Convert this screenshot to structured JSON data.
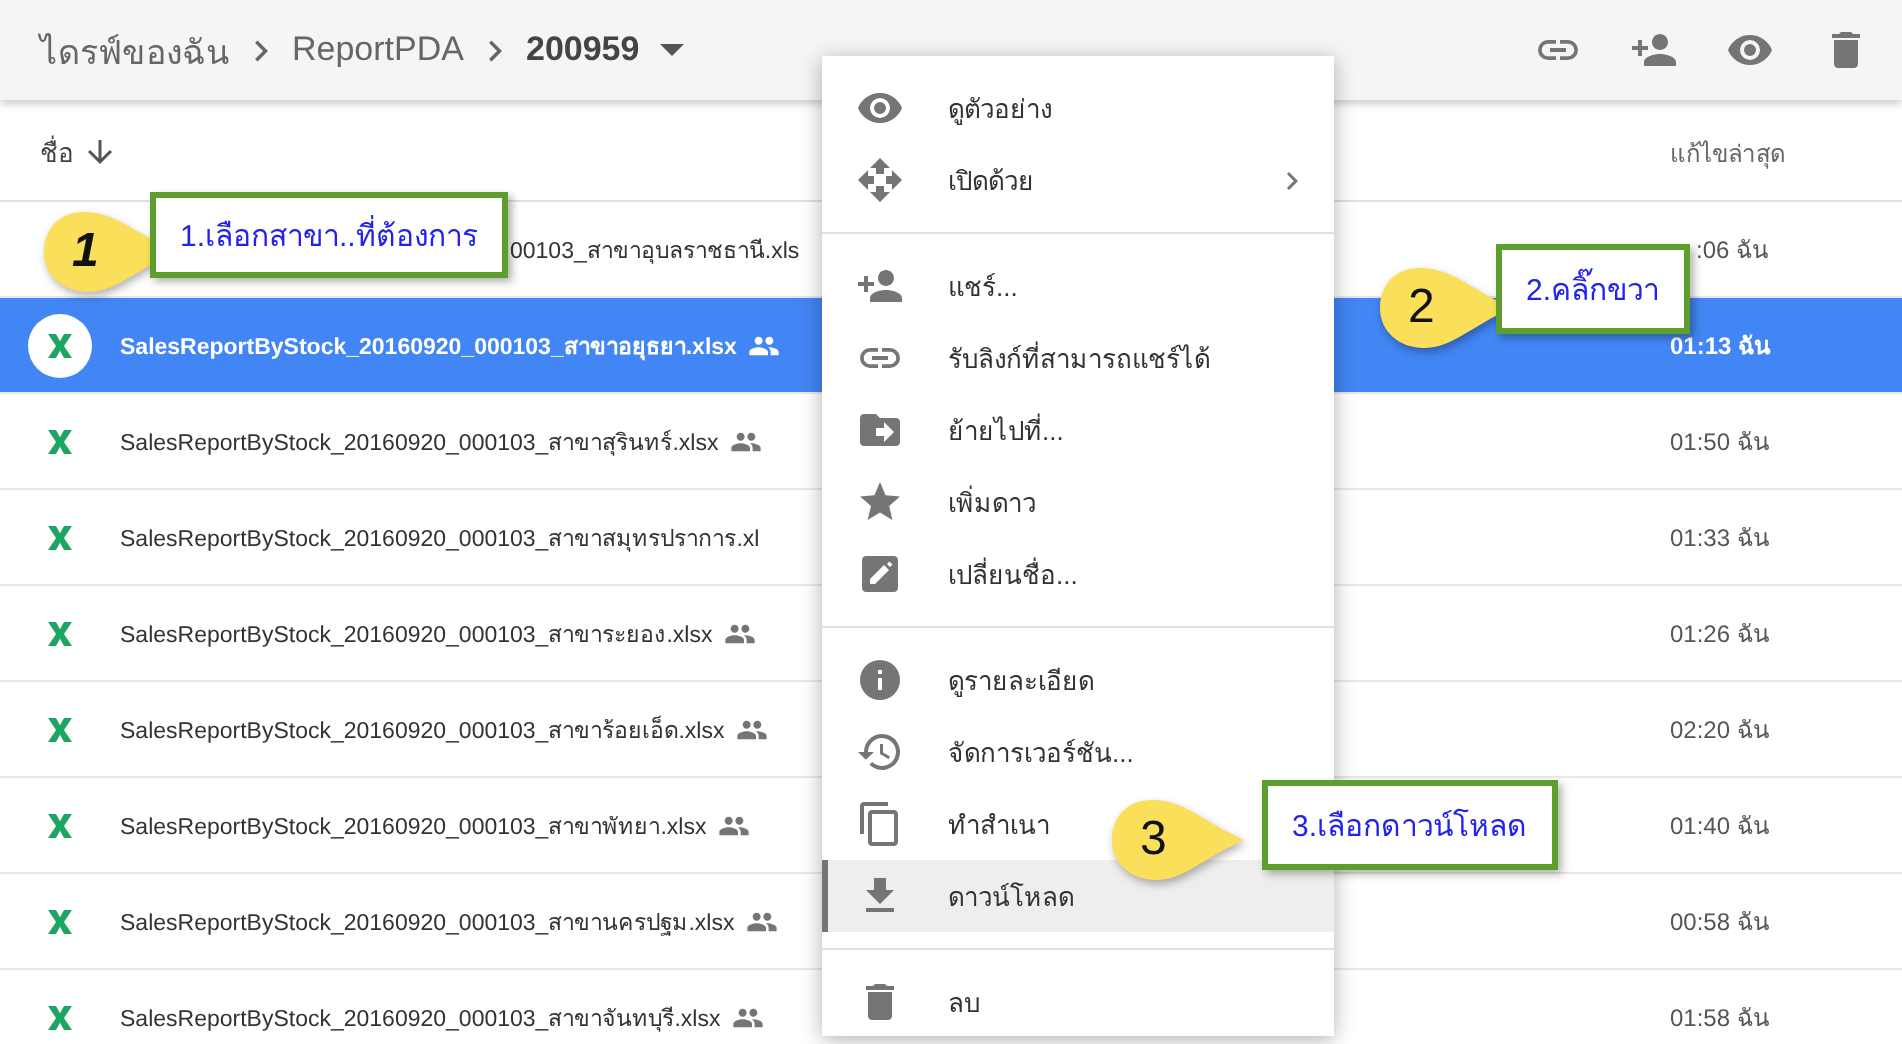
{
  "breadcrumb": [
    {
      "label": "ไดรฟ์ของฉัน",
      "current": false
    },
    {
      "label": "ReportPDA",
      "current": false
    },
    {
      "label": "200959",
      "current": true
    }
  ],
  "columns": {
    "name": "ชื่อ",
    "modified": "แก้ไขล่าสุด"
  },
  "rows": [
    {
      "name": "00103_สาขาอุบลราชธานี.xls",
      "modified": ":06 ฉัน",
      "selected": false
    },
    {
      "name": "SalesReportByStock_20160920_000103_สาขาอยุธยา.xlsx",
      "modified": "01:13 ฉัน",
      "selected": true,
      "shared": true
    },
    {
      "name": "SalesReportByStock_20160920_000103_สาขาสุรินทร์.xlsx",
      "modified": "01:50 ฉัน",
      "selected": false,
      "shared": true
    },
    {
      "name": "SalesReportByStock_20160920_000103_สาขาสมุทรปราการ.xl",
      "modified": "01:33 ฉัน",
      "selected": false
    },
    {
      "name": "SalesReportByStock_20160920_000103_สาขาระยอง.xlsx",
      "modified": "01:26 ฉัน",
      "selected": false,
      "shared": true
    },
    {
      "name": "SalesReportByStock_20160920_000103_สาขาร้อยเอ็ด.xlsx",
      "modified": "02:20 ฉัน",
      "selected": false,
      "shared": true
    },
    {
      "name": "SalesReportByStock_20160920_000103_สาขาพัทยา.xlsx",
      "modified": "01:40 ฉัน",
      "selected": false,
      "shared": true
    },
    {
      "name": "SalesReportByStock_20160920_000103_สาขานครปฐม.xlsx",
      "modified": "00:58 ฉัน",
      "selected": false,
      "shared": true
    },
    {
      "name": "SalesReportByStock_20160920_000103_สาขาจันทบุรี.xlsx",
      "modified": "01:58 ฉัน",
      "selected": false,
      "shared": true
    }
  ],
  "context_menu": {
    "groups": [
      [
        {
          "label": "ดูตัวอย่าง",
          "submenu": false,
          "selected": false
        },
        {
          "label": "เปิดด้วย",
          "submenu": true,
          "selected": false
        }
      ],
      [
        {
          "label": "แชร์...",
          "submenu": false,
          "selected": false
        },
        {
          "label": "รับลิงก์ที่สามารถแชร์ได้",
          "submenu": false,
          "selected": false
        },
        {
          "label": "ย้ายไปที่...",
          "submenu": false,
          "selected": false
        },
        {
          "label": "เพิ่มดาว",
          "submenu": false,
          "selected": false
        },
        {
          "label": "เปลี่ยนชื่อ...",
          "submenu": false,
          "selected": false
        }
      ],
      [
        {
          "label": "ดูรายละเอียด",
          "submenu": false,
          "selected": false
        },
        {
          "label": "จัดการเวอร์ชัน...",
          "submenu": false,
          "selected": false
        },
        {
          "label": "ทำสำเนา",
          "submenu": false,
          "selected": false
        },
        {
          "label": "ดาวน์โหลด",
          "submenu": false,
          "selected": true
        }
      ],
      [
        {
          "label": "ลบ",
          "submenu": false,
          "selected": false
        }
      ]
    ]
  },
  "callouts": [
    {
      "number": "1",
      "text": "1.เลือกสาขา..ที่ต้องการ"
    },
    {
      "number": "2",
      "text": "2.คลิ๊กขวา"
    },
    {
      "number": "3",
      "text": "3.เลือกดาวน์โหลด"
    }
  ]
}
